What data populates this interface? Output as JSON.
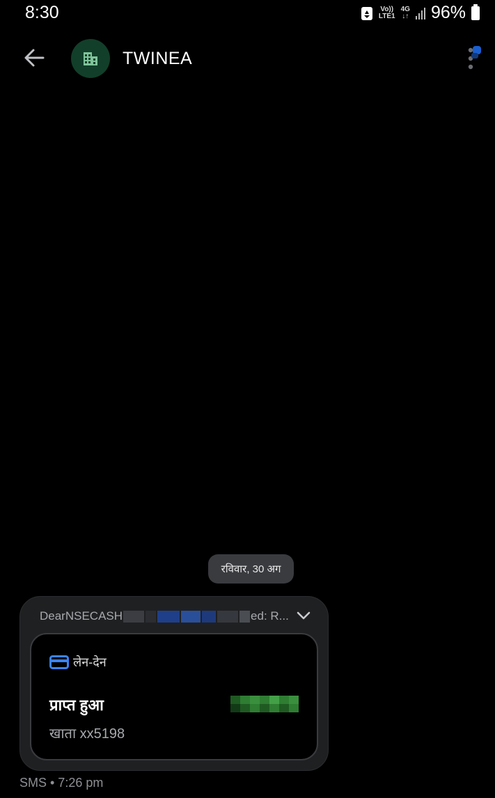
{
  "status_bar": {
    "time": "8:30",
    "volte_top": "Vo))",
    "volte_bottom": "LTE1",
    "net_top": "4G",
    "net_bottom": "↓↑",
    "battery": "96%",
    "icons": [
      "recycle-icon",
      "signal-icon",
      "battery-icon"
    ]
  },
  "header": {
    "title": "TWINEA",
    "avatar_icon": "building-icon",
    "avatar_color": "#123f2a"
  },
  "conversation": {
    "date_chip": "रविवार, 30 अग",
    "message": {
      "preview_start": "DearNSECASH",
      "preview_end": "ed: R...",
      "category": "लेन-देन",
      "headline": "प्राप्त हुआ",
      "account": "खाता xx5198",
      "meta": "SMS • 7:26 pm"
    }
  },
  "colors": {
    "background": "#000000",
    "bubble": "#1f2022",
    "chip": "#3a3b3f",
    "accent_blue": "#3b82f6"
  }
}
